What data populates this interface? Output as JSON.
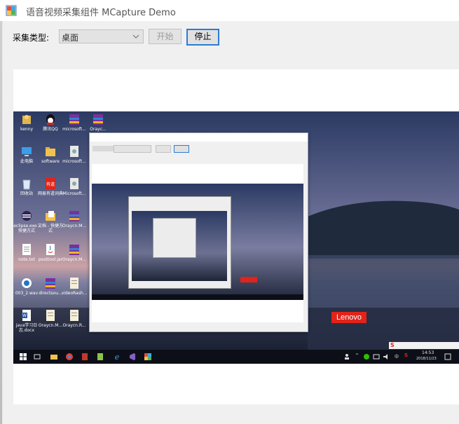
{
  "window": {
    "title": "语音视频采集组件 MCapture Demo"
  },
  "toolbar": {
    "type_label": "采集类型:",
    "type_selected": "桌面",
    "start_label": "开始",
    "stop_label": "停止"
  },
  "preview": {
    "desktop_icons": [
      {
        "label": "kenny",
        "icon": "user-folder-icon"
      },
      {
        "label": "腾讯QQ",
        "icon": "qq-icon"
      },
      {
        "label": "microsoft...",
        "icon": "archive-icon"
      },
      {
        "label": "Orayc...",
        "icon": "archive-icon"
      },
      {
        "label": "此电脑",
        "icon": "computer-icon"
      },
      {
        "label": "software",
        "icon": "folder-icon"
      },
      {
        "label": "microsoft...",
        "icon": "file-icon"
      },
      {
        "label": "回收站",
        "icon": "recycle-bin-icon"
      },
      {
        "label": "网易有道词典",
        "icon": "youdao-icon"
      },
      {
        "label": "Microsoft...",
        "icon": "file-icon"
      },
      {
        "label": "eclipse.exe - 快捷方式",
        "icon": "eclipse-icon"
      },
      {
        "label": "文档 - 快捷方式",
        "icon": "folder-icon"
      },
      {
        "label": "Oraycn.M...",
        "icon": "archive-icon"
      },
      {
        "label": "note.txt",
        "icon": "text-file-icon"
      },
      {
        "label": "posttool.jar",
        "icon": "java-icon"
      },
      {
        "label": "Oraycn.M...",
        "icon": "archive-icon"
      },
      {
        "label": "003_2.wav",
        "icon": "audio-file-icon"
      },
      {
        "label": "directsou...",
        "icon": "archive-icon"
      },
      {
        "label": "videoRash...",
        "icon": "document-icon"
      },
      {
        "label": "java学习日志.docx",
        "icon": "word-icon"
      },
      {
        "label": "Oraycn.M...",
        "icon": "document-icon"
      },
      {
        "label": "Oraycn.R...",
        "icon": "document-icon"
      }
    ],
    "brand_badge": "Lenovo",
    "tray_time": "14:53",
    "tray_date": "2018/11/23",
    "tray_ime": "中",
    "tray_ime_s": "S"
  }
}
